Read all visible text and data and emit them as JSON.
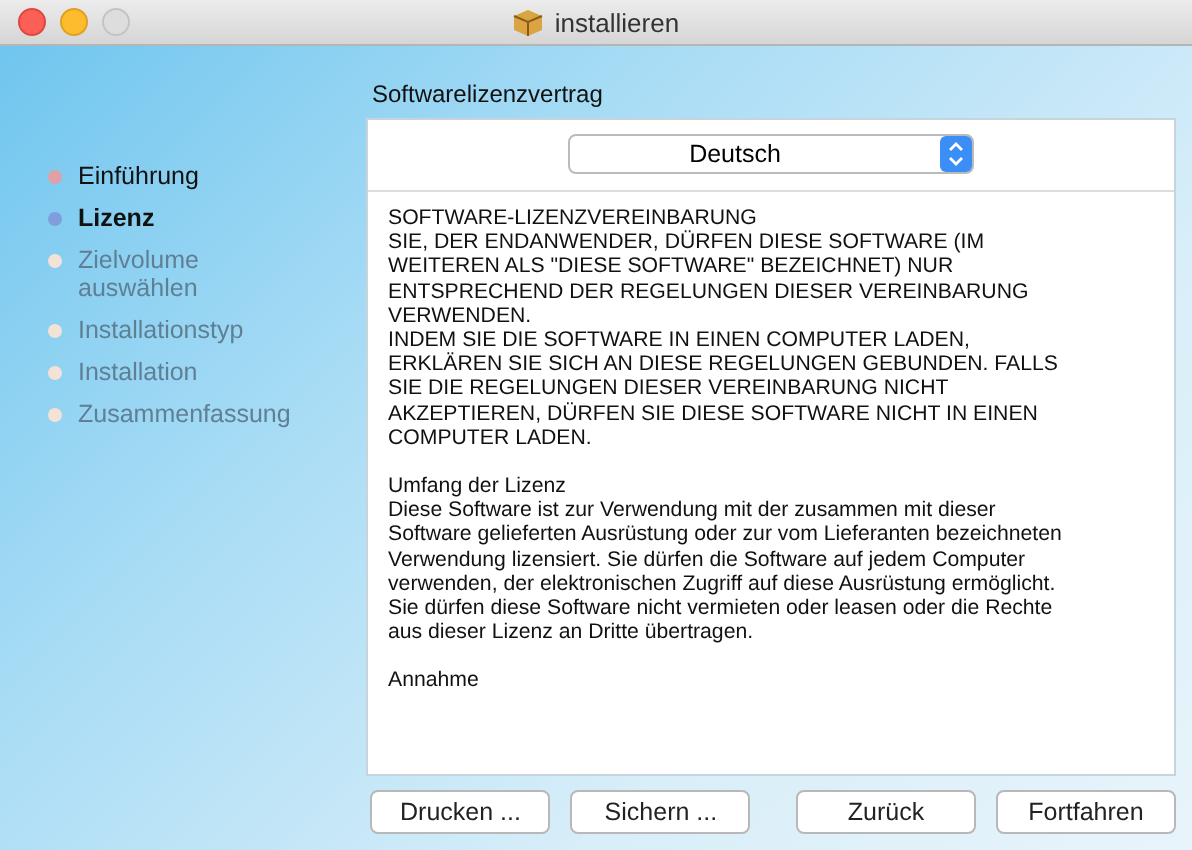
{
  "window": {
    "title": "installieren"
  },
  "steps": [
    {
      "label": "Einführung",
      "selected": false,
      "disabled": false
    },
    {
      "label": "Lizenz",
      "selected": true,
      "disabled": false
    },
    {
      "label": "Zielvolume auswählen",
      "selected": false,
      "disabled": true
    },
    {
      "label": "Installationstyp",
      "selected": false,
      "disabled": true
    },
    {
      "label": "Installation",
      "selected": false,
      "disabled": true
    },
    {
      "label": "Zusammenfassung",
      "selected": false,
      "disabled": true
    }
  ],
  "heading": "Softwarelizenzvertrag",
  "language": {
    "value": "Deutsch"
  },
  "license": [
    "SOFTWARE-LIZENZVEREINBARUNG\nSIE, DER ENDANWENDER, DÜRFEN DIESE SOFTWARE (IM\nWEITEREN ALS \"DIESE SOFTWARE\" BEZEICHNET) NUR\nENTSPRECHEND DER REGELUNGEN DIESER VEREINBARUNG\nVERWENDEN.\nINDEM SIE DIE SOFTWARE IN EINEN COMPUTER LADEN,\nERKLÄREN SIE SICH AN DIESE REGELUNGEN GEBUNDEN. FALLS\nSIE DIE REGELUNGEN DIESER VEREINBARUNG NICHT\nAKZEPTIEREN, DÜRFEN SIE DIESE SOFTWARE NICHT IN EINEN\nCOMPUTER LADEN.",
    "Umfang der Lizenz\nDiese Software ist zur Verwendung mit der zusammen mit dieser\nSoftware gelieferten Ausrüstung oder zur vom Lieferanten bezeichneten\nVerwendung lizensiert. Sie dürfen die Software auf jedem Computer\nverwenden, der elektronischen Zugriff auf diese Ausrüstung ermöglicht.\nSie dürfen diese Software nicht vermieten oder leasen oder die Rechte\naus dieser Lizenz an Dritte übertragen.",
    "Annahme"
  ],
  "buttons_left": [
    "Drucken ...",
    "Sichern ..."
  ],
  "buttons_right": [
    "Zurück",
    "Fortfahren"
  ]
}
